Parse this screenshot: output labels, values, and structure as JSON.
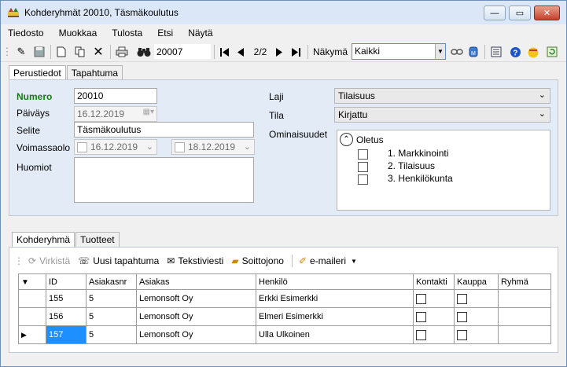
{
  "window": {
    "title": "Kohderyhmät 20010, Täsmäkoulutus"
  },
  "window_controls": {
    "minimize": "—",
    "maximize": "▭",
    "close": "✕"
  },
  "menu": [
    "Tiedosto",
    "Muokkaa",
    "Tulosta",
    "Etsi",
    "Näytä"
  ],
  "toolbar": {
    "search_value": "20007",
    "record_position": "2/2",
    "view_label": "Näkymä",
    "view_value": "Kaikki"
  },
  "tabs": [
    {
      "label": "Perustiedot",
      "active": true
    },
    {
      "label": "Tapahtuma",
      "active": false
    }
  ],
  "form": {
    "numero_label": "Numero",
    "numero_value": "20010",
    "paivays_label": "Päiväys",
    "paivays_value": "16.12.2019",
    "selite_label": "Selite",
    "selite_value": "Täsmäkoulutus",
    "voimassaolo_label": "Voimassaolo",
    "voim_from": "16.12.2019",
    "voim_to": "18.12.2019",
    "huomiot_label": "Huomiot",
    "huomiot_value": "",
    "laji_label": "Laji",
    "laji_value": "Tilaisuus",
    "tila_label": "Tila",
    "tila_value": "Kirjattu",
    "ominaisuudet_label": "Ominaisuudet",
    "ominaisuudet_group": "Oletus",
    "ominaisuudet_items": [
      "1. Markkinointi",
      "2. Tilaisuus",
      "3. Henkilökunta"
    ]
  },
  "subtabs": [
    {
      "label": "Kohderyhmä",
      "active": true
    },
    {
      "label": "Tuotteet",
      "active": false
    }
  ],
  "grid_toolbar": {
    "refresh": "Virkistä",
    "new_event": "Uusi tapahtuma",
    "sms": "Tekstiviesti",
    "call_queue": "Soittojono",
    "email": "e-maileri"
  },
  "grid": {
    "columns": [
      "ID",
      "Asiakasnr",
      "Asiakas",
      "Henkilö",
      "Kontakti",
      "Kauppa",
      "Ryhmä"
    ],
    "rows": [
      {
        "id": "155",
        "asiakasnr": "5",
        "asiakas": "Lemonsoft Oy",
        "henkilo": "Erkki Esimerkki",
        "kontakti": false,
        "kauppa": false,
        "ryhma": ""
      },
      {
        "id": "156",
        "asiakasnr": "5",
        "asiakas": "Lemonsoft Oy",
        "henkilo": "Elmeri Esimerkki",
        "kontakti": false,
        "kauppa": false,
        "ryhma": ""
      },
      {
        "id": "157",
        "asiakasnr": "5",
        "asiakas": "Lemonsoft Oy",
        "henkilo": "Ulla Ulkoinen",
        "kontakti": false,
        "kauppa": false,
        "ryhma": "",
        "current": true
      }
    ]
  },
  "colors": {
    "accent": "#1e8fff",
    "panel_bg": "#e3ebf6",
    "label_green": "#1a7a1a"
  }
}
